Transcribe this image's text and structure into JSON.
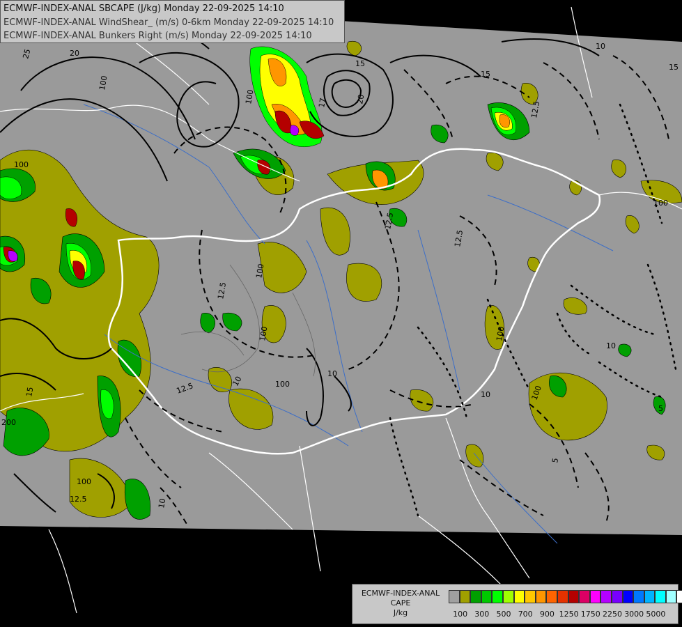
{
  "header": {
    "line1": "ECMWF-INDEX-ANAL SBCAPE (J/kg) Monday 22-09-2025 14:10",
    "line2": "ECMWF-INDEX-ANAL WindShear_ (m/s) 0-6km Monday 22-09-2025 14:10",
    "line3": "ECMWF-INDEX-ANAL Bunkers Right (m/s) Monday 22-09-2025 14:10"
  },
  "legend": {
    "title_line1": "ECMWF-INDEX-ANAL",
    "title_line2": "CAPE",
    "title_line3": "J/kg",
    "colors": [
      "#a0a0a0",
      "#a0a000",
      "#00a000",
      "#00c800",
      "#00ff00",
      "#a0ff00",
      "#ffff00",
      "#ffc800",
      "#ff9600",
      "#ff6400",
      "#e63200",
      "#b40000",
      "#dc0064",
      "#ff00ff",
      "#b400ff",
      "#7800ff",
      "#0000ff",
      "#0078ff",
      "#00b4ff",
      "#00ffff",
      "#a0ffff",
      "#ffffff"
    ],
    "labels": [
      "100",
      "300",
      "500",
      "700",
      "900",
      "1250",
      "1750",
      "2250",
      "3000",
      "5000"
    ]
  },
  "contour_labels": [
    {
      "text": "25"
    },
    {
      "text": "20"
    },
    {
      "text": "20"
    },
    {
      "text": "15"
    },
    {
      "text": "15"
    },
    {
      "text": "17"
    },
    {
      "text": "10"
    },
    {
      "text": "12.5"
    },
    {
      "text": "12.5"
    },
    {
      "text": "12.5"
    },
    {
      "text": "12.5"
    },
    {
      "text": "12.5"
    },
    {
      "text": "100"
    },
    {
      "text": "100"
    },
    {
      "text": "100"
    },
    {
      "text": "100"
    },
    {
      "text": "100"
    },
    {
      "text": "100"
    },
    {
      "text": "100"
    },
    {
      "text": "100"
    },
    {
      "text": "100"
    },
    {
      "text": "10"
    },
    {
      "text": "10"
    },
    {
      "text": "10"
    },
    {
      "text": "5"
    },
    {
      "text": "5"
    },
    {
      "text": "15"
    },
    {
      "text": "200"
    },
    {
      "text": "100"
    },
    {
      "text": "15"
    },
    {
      "text": "12.5"
    },
    {
      "text": "10"
    },
    {
      "text": "10"
    }
  ]
}
